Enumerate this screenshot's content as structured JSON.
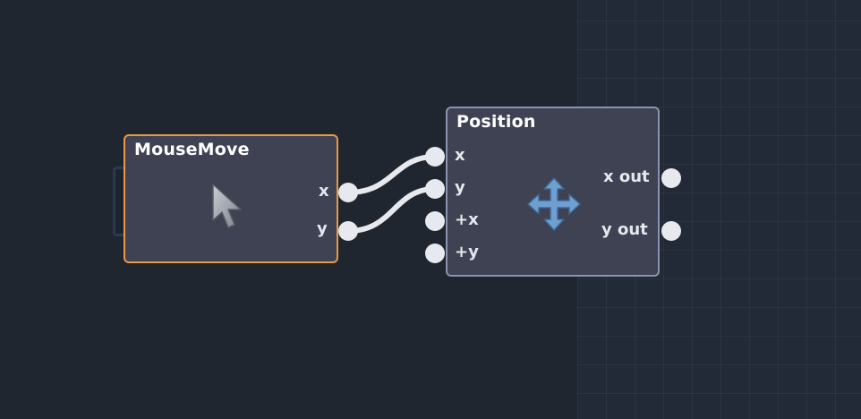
{
  "canvas": {
    "nodes": {
      "mouse_move": {
        "title": "MouseMove",
        "icon": "cursor-arrow-icon",
        "accent": "#e89a45",
        "outputs": [
          "x",
          "y"
        ]
      },
      "position": {
        "title": "Position",
        "icon": "move-arrows-icon",
        "accent": "#8c93b0",
        "inputs": [
          "x",
          "y",
          "+x",
          "+y"
        ],
        "outputs": [
          "x out",
          "y out"
        ]
      }
    },
    "connections": [
      {
        "from": "MouseMove.x",
        "to": "Position.x"
      },
      {
        "from": "MouseMove.y",
        "to": "Position.y"
      }
    ]
  }
}
